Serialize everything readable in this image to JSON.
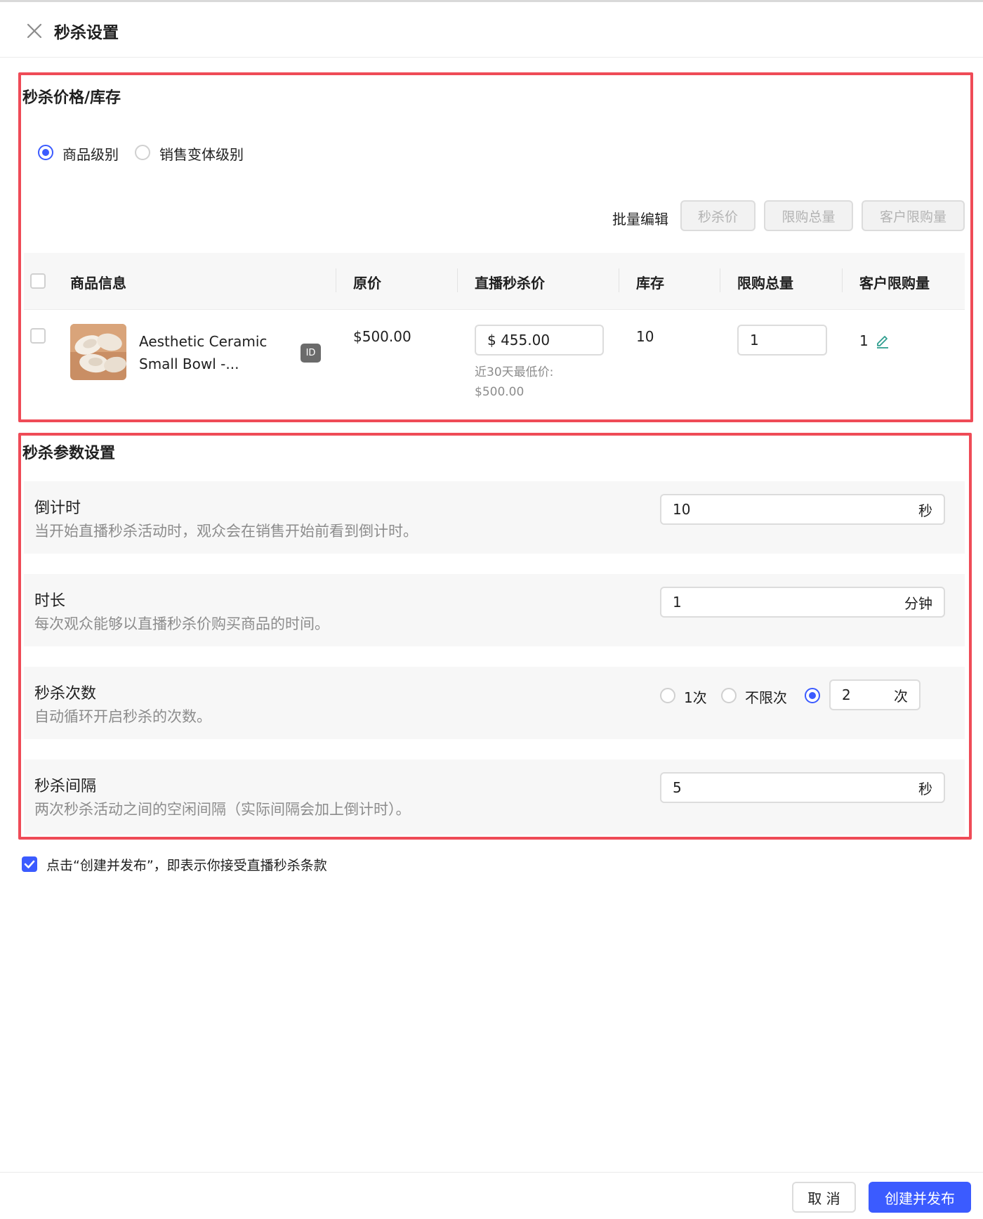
{
  "header": {
    "title": "秒杀设置"
  },
  "price_section": {
    "title": "秒杀价格/库存",
    "level_options": [
      {
        "label": "商品级别",
        "selected": true
      },
      {
        "label": "销售变体级别",
        "selected": false
      }
    ],
    "batch": {
      "label": "批量编辑",
      "buttons": [
        "秒杀价",
        "限购总量",
        "客户限购量"
      ]
    },
    "table": {
      "columns": [
        "商品信息",
        "原价",
        "直播秒杀价",
        "库存",
        "限购总量",
        "客户限购量"
      ],
      "rows": [
        {
          "product_name": "Aesthetic Ceramic Small Bowl -...",
          "id_badge": "ID",
          "original_price": "$500.00",
          "flash_price": "$ 455.00",
          "lowest_30d_label": "近30天最低价:",
          "lowest_30d_value": "$500.00",
          "stock": "10",
          "total_limit": "1",
          "customer_limit": "1"
        }
      ]
    }
  },
  "params_section": {
    "title": "秒杀参数设置",
    "countdown": {
      "label": "倒计时",
      "desc": "当开始直播秒杀活动时，观众会在销售开始前看到倒计时。",
      "value": "10",
      "unit": "秒"
    },
    "duration": {
      "label": "时长",
      "desc": "每次观众能够以直播秒杀价购买商品的时间。",
      "value": "1",
      "unit": "分钟"
    },
    "times": {
      "label": "秒杀次数",
      "desc": "自动循环开启秒杀的次数。",
      "options": [
        {
          "label": "1次",
          "selected": false
        },
        {
          "label": "不限次",
          "selected": false
        }
      ],
      "custom_selected": true,
      "custom_value": "2",
      "custom_unit": "次"
    },
    "interval": {
      "label": "秒杀间隔",
      "desc": "两次秒杀活动之间的空闲间隔（实际间隔会加上倒计时）。",
      "value": "5",
      "unit": "秒"
    }
  },
  "agreement": {
    "checked": true,
    "text": "点击“创建并发布”，即表示你接受直播秒杀条款"
  },
  "footer": {
    "cancel_label": "取 消",
    "submit_label": "创建并发布"
  },
  "colors": {
    "accent": "#3b5bff",
    "highlight": "#ef4b57",
    "muted": "#8c8c8c"
  }
}
